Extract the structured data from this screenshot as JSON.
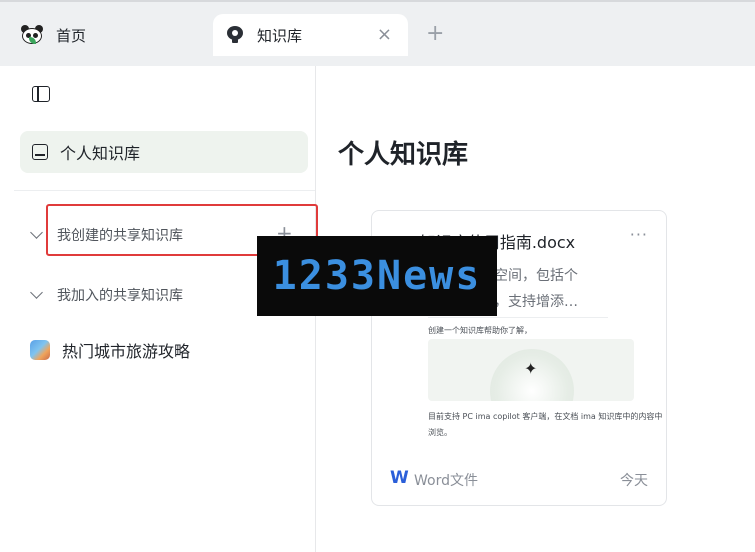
{
  "tabs": {
    "home_label": "首页",
    "knowledge_label": "知识库",
    "close_symbol": "×",
    "new_tab_symbol": "+"
  },
  "sidebar": {
    "personal_label": "个人知识库",
    "created_group_label": "我创建的共享知识库",
    "add_symbol": "+",
    "joined_group_label": "我加入的共享知识库",
    "city_label": "热门城市旅游攻略"
  },
  "main": {
    "title": "个人知识库",
    "card": {
      "title": "ima知识库使用指南.docx",
      "more": "···",
      "line1": "的专属空间，包括个",
      "line2": "知识库，支持增添…",
      "small1": "创建一个知识库帮助你了解，",
      "small2": "目前支持 PC ima copilot 客户端，在文档 ima 知识库中的内容中",
      "small3": "浏览。",
      "spark": "✦",
      "file_type_icon": "W",
      "file_type": "Word文件",
      "date": "今天"
    }
  },
  "watermark": {
    "text": "1233News"
  },
  "colors": {
    "highlight": "#e03b3b",
    "active_nav_bg": "#eef3ee",
    "word_blue": "#2b5fd9",
    "watermark_text": "#3b8fe0"
  },
  "icons": [
    "panda-logo-icon",
    "bulb-icon",
    "close-icon",
    "plus-icon",
    "sidebar-toggle-icon",
    "knowledge-box-icon",
    "chevron-down-icon",
    "city-thumbnail-icon",
    "more-icon",
    "word-icon"
  ]
}
